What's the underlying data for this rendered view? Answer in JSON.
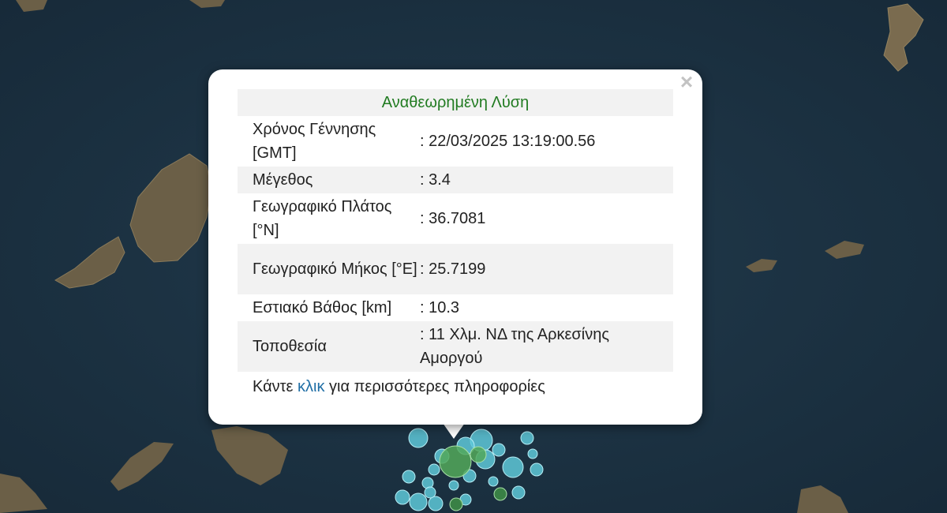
{
  "popup": {
    "header": "Αναθεωρημένη Λύση",
    "close_label": "×",
    "rows": [
      {
        "label": "Χρόνος Γέννησης [GMT]",
        "value": ": 22/03/2025 13:19:00.56"
      },
      {
        "label": "Μέγεθος",
        "value": ": 3.4"
      },
      {
        "label": "Γεωγραφικό Πλάτος [°N]",
        "value": ": 36.7081"
      },
      {
        "label": "Γεωγραφικό Μήκος [°E]",
        "value": ": 25.7199"
      },
      {
        "label": "Εστιακό Βάθος [km]",
        "value": ": 10.3"
      },
      {
        "label": "Τοποθεσία",
        "value": ": 11 Χλμ. ΝΔ της Αρκεσίνης Αμοργού"
      }
    ],
    "more_prefix": "Κάντε ",
    "more_link": "κλικ",
    "more_suffix": " για περισσότερες πληροφορίες"
  },
  "map": {
    "sea_color": "#1c3243",
    "land_color": "#6e6249",
    "marker_cyan": "#5ec8d8",
    "marker_green": "#52a85a"
  }
}
